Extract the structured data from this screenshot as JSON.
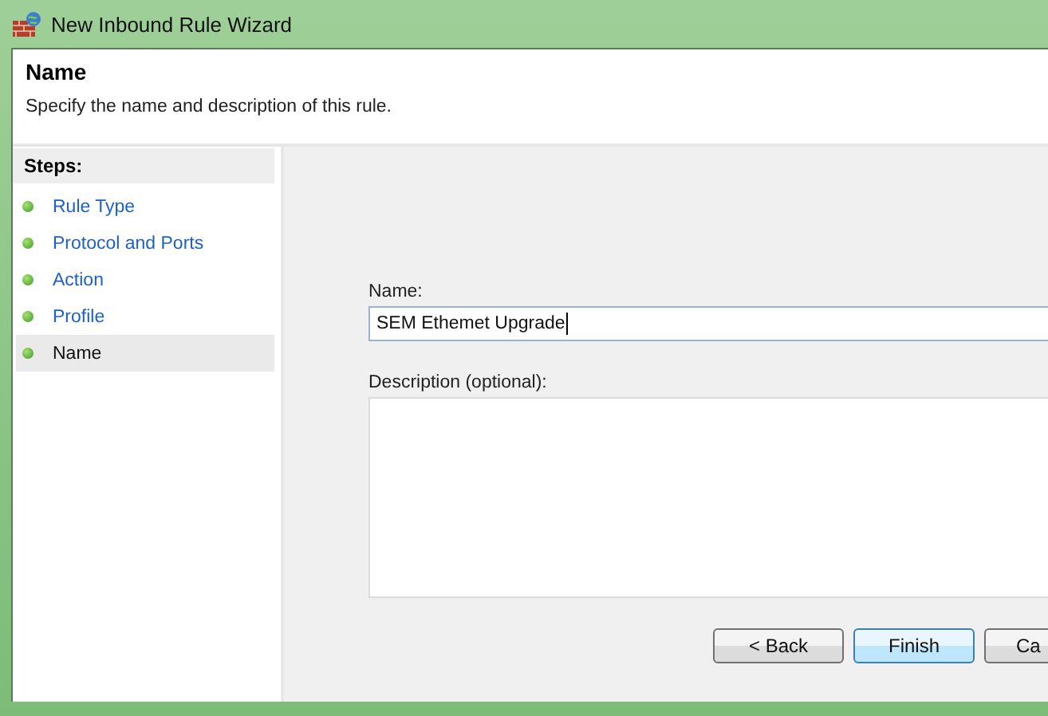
{
  "window": {
    "title": "New Inbound Rule Wizard"
  },
  "header": {
    "title": "Name",
    "subtitle": "Specify the name and description of this rule."
  },
  "steps": {
    "heading": "Steps:",
    "items": [
      {
        "label": "Rule Type",
        "selected": false
      },
      {
        "label": "Protocol and Ports",
        "selected": false
      },
      {
        "label": "Action",
        "selected": false
      },
      {
        "label": "Profile",
        "selected": false
      },
      {
        "label": "Name",
        "selected": true
      }
    ]
  },
  "form": {
    "name_label": "Name:",
    "name_value": "SEM Ethemet Upgrade",
    "description_label": "Description (optional):"
  },
  "buttons": [
    {
      "label": "< Back",
      "kind": "normal"
    },
    {
      "label": "Finish",
      "kind": "default"
    },
    {
      "label": "Ca",
      "kind": "cut"
    }
  ]
}
